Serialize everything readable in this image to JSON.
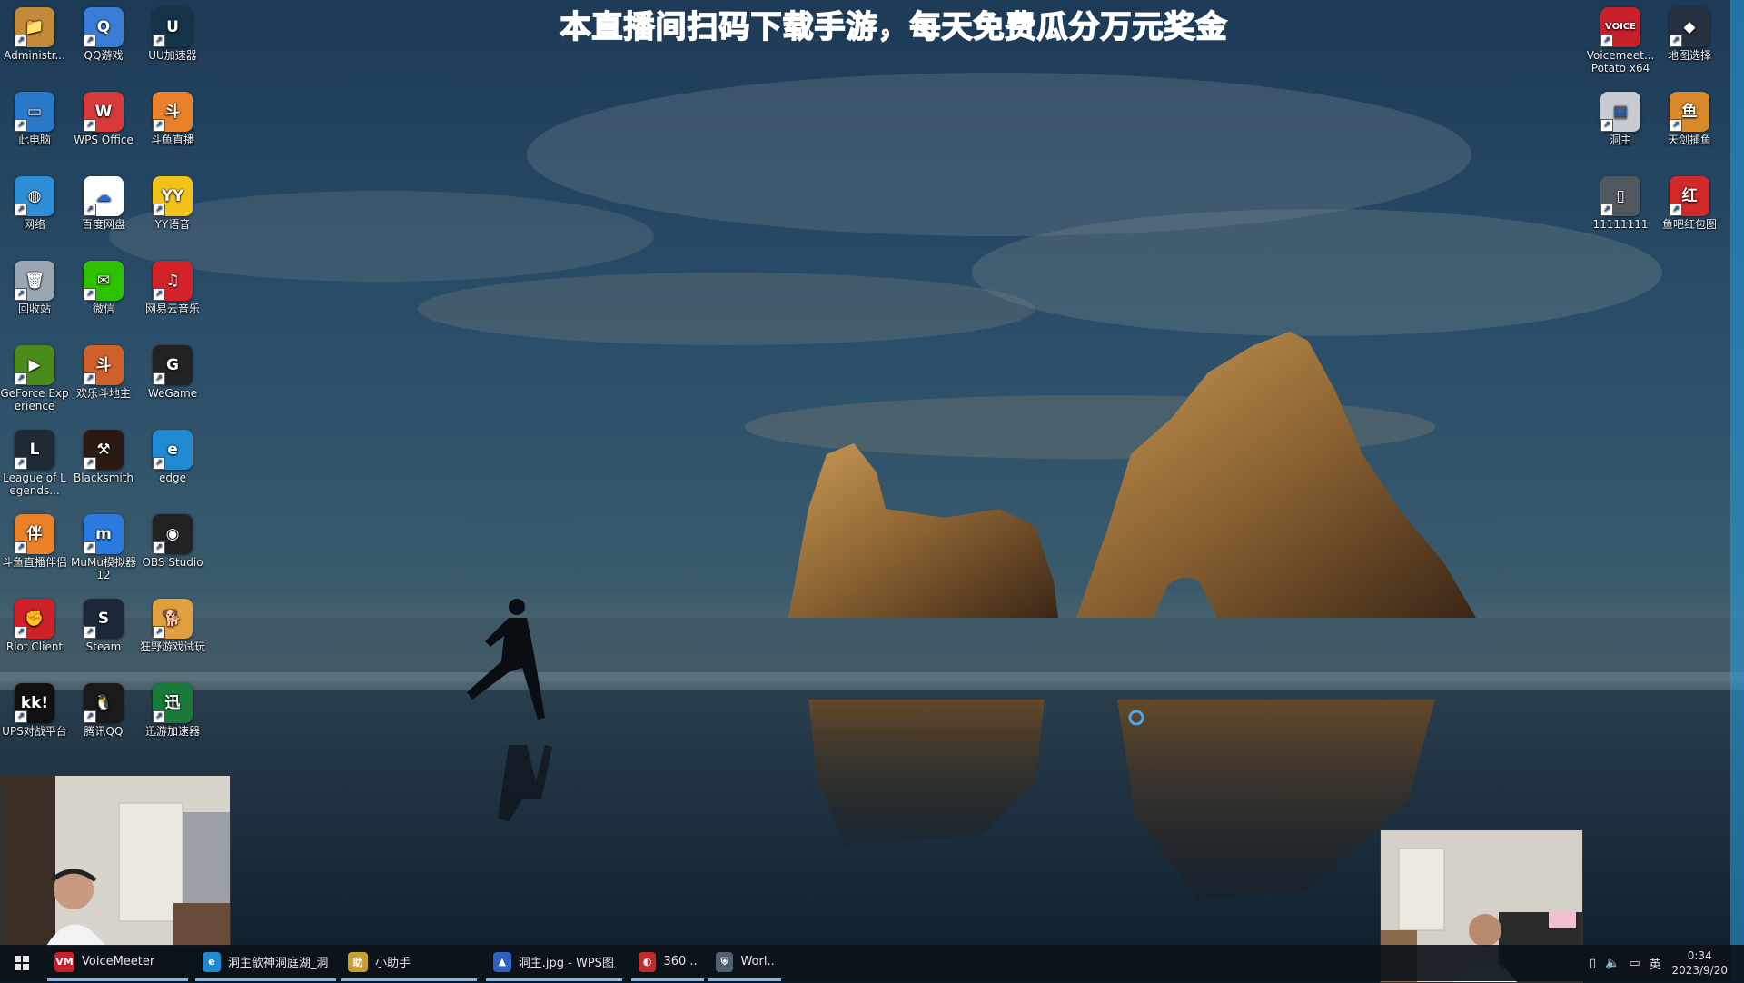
{
  "banner": {
    "text": "本直播间扫码下载手游，每天免费瓜分万元奖金"
  },
  "desktop": {
    "left_icons": [
      {
        "label": "Administr...",
        "color": "#c28a3a",
        "glyph": "📁",
        "icon": "folder-user-icon"
      },
      {
        "label": "QQ游戏",
        "color": "#3a7bd5",
        "glyph": "Q",
        "icon": "qq-game-icon"
      },
      {
        "label": "UU加速器",
        "color": "#143248",
        "glyph": "U",
        "icon": "uu-accelerator-icon"
      },
      {
        "label": "此电脑",
        "color": "#2a78c8",
        "glyph": "▭",
        "icon": "this-pc-icon"
      },
      {
        "label": "WPS Office",
        "color": "#d63a3a",
        "glyph": "W",
        "icon": "wps-office-icon"
      },
      {
        "label": "斗鱼直播",
        "color": "#e8812a",
        "glyph": "斗",
        "icon": "douyu-icon"
      },
      {
        "label": "网络",
        "color": "#2f8fd6",
        "glyph": "◍",
        "icon": "network-icon"
      },
      {
        "label": "百度网盘",
        "color": "#ffffff",
        "glyph": "☁",
        "icon": "baidu-netdisk-icon"
      },
      {
        "label": "YY语音",
        "color": "#f2c21b",
        "glyph": "YY",
        "icon": "yy-voice-icon"
      },
      {
        "label": "回收站",
        "color": "#9aa6b2",
        "glyph": "🗑",
        "icon": "recycle-bin-icon"
      },
      {
        "label": "微信",
        "color": "#2dc100",
        "glyph": "✉",
        "icon": "wechat-icon"
      },
      {
        "label": "网易云音乐",
        "color": "#d2232a",
        "glyph": "♫",
        "icon": "netease-music-icon"
      },
      {
        "label": "GeForce Experience",
        "color": "#4a8a1a",
        "glyph": "▶",
        "icon": "geforce-icon"
      },
      {
        "label": "欢乐斗地主",
        "color": "#d0602a",
        "glyph": "斗",
        "icon": "doudizhu-icon"
      },
      {
        "label": "WeGame",
        "color": "#222222",
        "glyph": "G",
        "icon": "wegame-icon"
      },
      {
        "label": "League of Legends...",
        "color": "#1e2a36",
        "glyph": "L",
        "icon": "league-of-legends-icon"
      },
      {
        "label": "Blacksmith",
        "color": "#2a1a12",
        "glyph": "⚒",
        "icon": "blacksmith-icon"
      },
      {
        "label": "edge",
        "color": "#1f8ad2",
        "glyph": "e",
        "icon": "edge-icon"
      },
      {
        "label": "斗鱼直播伴侣",
        "color": "#e8812a",
        "glyph": "伴",
        "icon": "douyu-companion-icon"
      },
      {
        "label": "MuMu模拟器12",
        "color": "#2a7ae0",
        "glyph": "m",
        "icon": "mumu-emulator-icon"
      },
      {
        "label": "OBS Studio",
        "color": "#222222",
        "glyph": "◉",
        "icon": "obs-studio-icon"
      },
      {
        "label": "Riot Client",
        "color": "#d0202a",
        "glyph": "✊",
        "icon": "riot-client-icon"
      },
      {
        "label": "Steam",
        "color": "#1b2838",
        "glyph": "S",
        "icon": "steam-icon"
      },
      {
        "label": "狂野游戏试玩",
        "color": "#e0a040",
        "glyph": "🐕",
        "icon": "wild-game-icon"
      },
      {
        "label": "UPS对战平台",
        "color": "#111111",
        "glyph": "kk!",
        "icon": "kk-platform-icon"
      },
      {
        "label": "腾讯QQ",
        "color": "#1a1a1a",
        "glyph": "🐧",
        "icon": "tencent-qq-icon"
      },
      {
        "label": "迅游加速器",
        "color": "#1a7a3a",
        "glyph": "迅",
        "icon": "xunyou-accelerator-icon"
      }
    ],
    "right_icons": [
      {
        "label": "Voicemeet... Potato x64",
        "color": "#c8202a",
        "glyph": "VOICE",
        "icon": "voicemeeter-icon"
      },
      {
        "label": "地图选择",
        "color": "#253040",
        "glyph": "◆",
        "icon": "map-select-icon"
      },
      {
        "label": "洞主",
        "color": "#c8ccd2",
        "glyph": "▤",
        "icon": "dongzhu-image-icon"
      },
      {
        "label": "天剑捕鱼",
        "color": "#d88a2a",
        "glyph": "鱼",
        "icon": "fishing-game-icon"
      },
      {
        "label": "11111111",
        "color": "#505860",
        "glyph": "▯",
        "icon": "file-11111111-icon"
      },
      {
        "label": "鱼吧红包图",
        "color": "#d02a2a",
        "glyph": "红",
        "icon": "red-packet-image-icon"
      }
    ]
  },
  "taskbar": {
    "start_icon": "windows-start-icon",
    "items": [
      {
        "label": "VoiceMeeter",
        "color": "#c8202a",
        "glyph": "VM"
      },
      {
        "label": "洞主歆神洞庭湖_洞...",
        "color": "#1f8ad2",
        "glyph": "e"
      },
      {
        "label": "小助手",
        "color": "#c8a030",
        "glyph": "助"
      },
      {
        "label": "洞主.jpg - WPS图片",
        "color": "#3060c0",
        "glyph": "▲"
      },
      {
        "label": "360 ...",
        "color": "#c02a2a",
        "glyph": "◐"
      },
      {
        "label": "Worl...",
        "color": "#506070",
        "glyph": "⛨"
      }
    ],
    "tray": {
      "lang": "英",
      "time": "0:34",
      "date": "2023/9/20"
    }
  },
  "colors": {
    "accent": "#76b9ed",
    "banner_red": "#e8131b"
  }
}
